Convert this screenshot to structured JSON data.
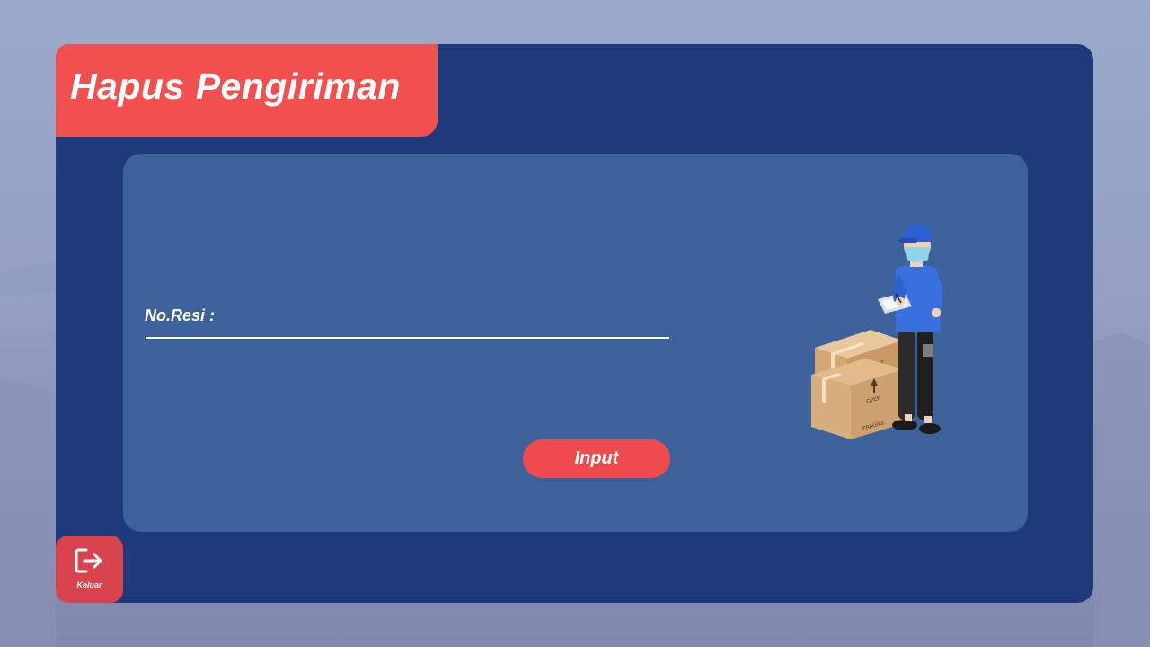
{
  "header": {
    "title": "Hapus Pengiriman"
  },
  "form": {
    "label": "No.Resi :",
    "value": "",
    "submit_label": "Input"
  },
  "exit": {
    "label": "Keluar",
    "icon": "logout-icon"
  },
  "illustration": {
    "icon": "courier-with-boxes-illustration",
    "box_labels": {
      "fragile": "FRAGILE",
      "open": "OPEN"
    }
  },
  "colors": {
    "window": "#1e3a7b",
    "panel": "#3d619a",
    "accent": "#f24f4f",
    "background": "#9ba9cc"
  }
}
